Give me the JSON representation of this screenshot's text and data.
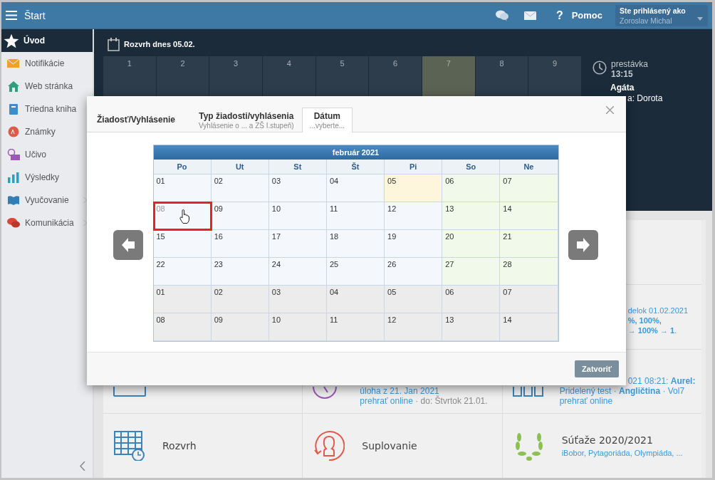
{
  "topbar": {
    "title": "Štart",
    "help_icon": "?",
    "help": "Pomoc",
    "user_label": "Ste prihlásený ako",
    "user_name": "Zoroslav Michal"
  },
  "sidebar": {
    "items": [
      {
        "label": "Úvod",
        "selected": true,
        "submenu": false
      },
      {
        "label": "Notifikácie",
        "selected": false,
        "submenu": false
      },
      {
        "label": "Web stránka",
        "selected": false,
        "submenu": false
      },
      {
        "label": "Triedna kniha",
        "selected": false,
        "submenu": false
      },
      {
        "label": "Známky",
        "selected": false,
        "submenu": false
      },
      {
        "label": "Učivo",
        "selected": false,
        "submenu": false
      },
      {
        "label": "Výsledky",
        "selected": false,
        "submenu": false
      },
      {
        "label": "Vyučovanie",
        "selected": false,
        "submenu": true
      },
      {
        "label": "Komunikácia",
        "selected": false,
        "submenu": true
      }
    ]
  },
  "schedule": {
    "title": "Rozvrh dnes 05.02.",
    "periods": [
      {
        "label": "1",
        "current": false
      },
      {
        "label": "2",
        "current": false
      },
      {
        "label": "3",
        "current": false
      },
      {
        "label": "4",
        "current": false
      },
      {
        "label": "5",
        "current": false
      },
      {
        "label": "6",
        "current": false
      },
      {
        "label": "7",
        "current": true
      },
      {
        "label": "8",
        "current": false
      },
      {
        "label": "9",
        "current": false
      }
    ],
    "break_label": "prestávka",
    "break_time": "13:15",
    "teacher_name": "Agáta",
    "teacher_line": "a: Dorota"
  },
  "tile_rows": [
    {
      "right": {
        "lines": [
          "delok 01.02.2021",
          "**%, 100%,**",
          "→ **100%** → **1**."
        ]
      }
    },
    {
      "middle": {
        "lines": [
          "úloha z 21. Jan 2021"
        ],
        "link": "prehrať online",
        "note": " · do: Štvrtok 21.01."
      },
      "right": {
        "lines": [
          "021 08:21: **Aurel:**",
          "Pridelený test · **Angličtina** · Vol7"
        ],
        "link": "prehrať online"
      }
    },
    {
      "left": {
        "title": "Rozvrh"
      },
      "middle": {
        "title": "Suplovanie"
      },
      "right": {
        "title": "Súťaže 2020/2021",
        "lines": [
          "iBobor, Pytagoriáda, Olympiáda, ..."
        ]
      }
    }
  ],
  "modal": {
    "label": "Žiadosť/Vyhlásenie",
    "tabs": [
      {
        "title": "Typ žiadosti/vyhlásenia",
        "subtitle": "Vyhlásenie o ... a ZŠ I.stupeň)",
        "selected": false
      },
      {
        "title": "Dátum",
        "subtitle": "...vyberte...",
        "selected": true
      }
    ],
    "calendar": {
      "title": "február 2021",
      "weekdays": [
        "Po",
        "Ut",
        "St",
        "Št",
        "Pi",
        "So",
        "Ne"
      ],
      "weeks": [
        [
          {
            "day": "01",
            "kind": "weekday",
            "selected": false
          },
          {
            "day": "02",
            "kind": "weekday",
            "selected": false
          },
          {
            "day": "03",
            "kind": "weekday",
            "selected": false
          },
          {
            "day": "04",
            "kind": "weekday",
            "selected": false
          },
          {
            "day": "05",
            "kind": "today",
            "selected": false
          },
          {
            "day": "06",
            "kind": "weekend",
            "selected": false
          },
          {
            "day": "07",
            "kind": "weekend",
            "selected": false
          }
        ],
        [
          {
            "day": "08",
            "kind": "weekday",
            "selected": true
          },
          {
            "day": "09",
            "kind": "weekday",
            "selected": false
          },
          {
            "day": "10",
            "kind": "weekday",
            "selected": false
          },
          {
            "day": "11",
            "kind": "weekday",
            "selected": false
          },
          {
            "day": "12",
            "kind": "weekday",
            "selected": false
          },
          {
            "day": "13",
            "kind": "weekend",
            "selected": false
          },
          {
            "day": "14",
            "kind": "weekend",
            "selected": false
          }
        ],
        [
          {
            "day": "15",
            "kind": "weekday",
            "selected": false
          },
          {
            "day": "16",
            "kind": "weekday",
            "selected": false
          },
          {
            "day": "17",
            "kind": "weekday",
            "selected": false
          },
          {
            "day": "18",
            "kind": "weekday",
            "selected": false
          },
          {
            "day": "19",
            "kind": "weekday",
            "selected": false
          },
          {
            "day": "20",
            "kind": "weekend",
            "selected": false
          },
          {
            "day": "21",
            "kind": "weekend",
            "selected": false
          }
        ],
        [
          {
            "day": "22",
            "kind": "weekday",
            "selected": false
          },
          {
            "day": "23",
            "kind": "weekday",
            "selected": false
          },
          {
            "day": "24",
            "kind": "weekday",
            "selected": false
          },
          {
            "day": "25",
            "kind": "weekday",
            "selected": false
          },
          {
            "day": "26",
            "kind": "weekday",
            "selected": false
          },
          {
            "day": "27",
            "kind": "weekend",
            "selected": false
          },
          {
            "day": "28",
            "kind": "weekend",
            "selected": false
          }
        ],
        [
          {
            "day": "01",
            "kind": "other",
            "selected": false
          },
          {
            "day": "02",
            "kind": "other",
            "selected": false
          },
          {
            "day": "03",
            "kind": "other",
            "selected": false
          },
          {
            "day": "04",
            "kind": "other",
            "selected": false
          },
          {
            "day": "05",
            "kind": "other",
            "selected": false
          },
          {
            "day": "06",
            "kind": "other",
            "selected": false
          },
          {
            "day": "07",
            "kind": "other",
            "selected": false
          }
        ],
        [
          {
            "day": "08",
            "kind": "other",
            "selected": false
          },
          {
            "day": "09",
            "kind": "other",
            "selected": false
          },
          {
            "day": "10",
            "kind": "other",
            "selected": false
          },
          {
            "day": "11",
            "kind": "other",
            "selected": false
          },
          {
            "day": "12",
            "kind": "other",
            "selected": false
          },
          {
            "day": "13",
            "kind": "other",
            "selected": false
          },
          {
            "day": "14",
            "kind": "other",
            "selected": false
          }
        ]
      ]
    },
    "close_button": "Zatvoriť"
  }
}
